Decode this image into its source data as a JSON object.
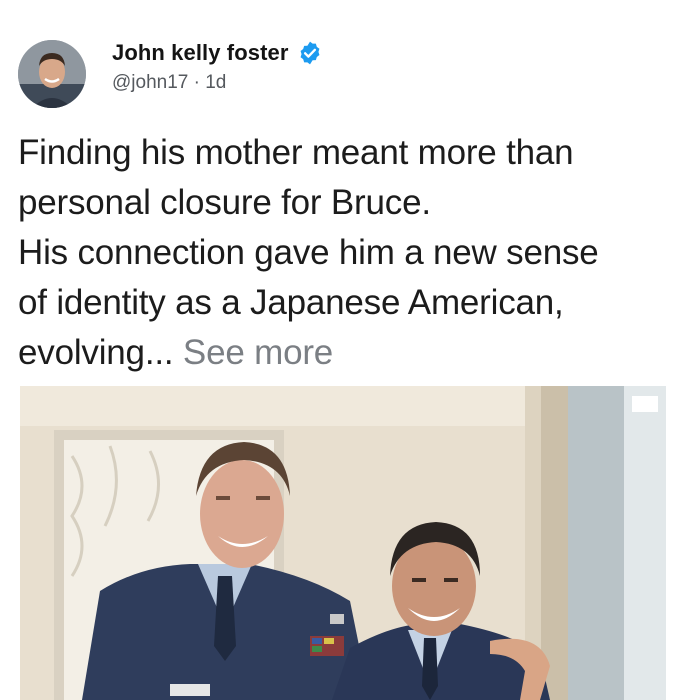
{
  "author": {
    "name": "John kelly foster",
    "handle": "@john17",
    "separator": "·",
    "time": "1d",
    "verified": true,
    "avatar_icon": "profile-photo"
  },
  "post": {
    "lines": [
      "Finding his mother meant more than",
      "personal closure for Bruce.",
      "His connection gave him a new sense",
      "of identity as a Japanese American,"
    ],
    "last_line": "evolving...",
    "see_more_label": "See more"
  },
  "media": {
    "type": "photo"
  },
  "colors": {
    "verified_badge": "#1d9bf0",
    "see_more": "#7b7f84",
    "uniform": "#2f3d5c"
  }
}
